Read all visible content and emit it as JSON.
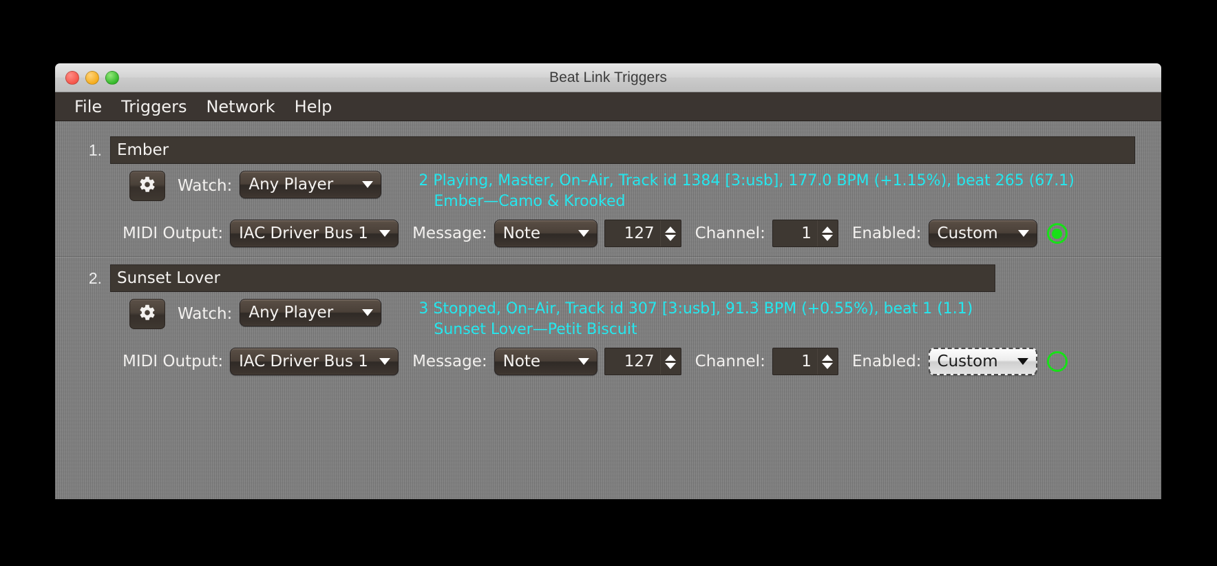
{
  "window": {
    "title": "Beat Link Triggers",
    "traffic_lights": [
      "close-button",
      "minimize-button",
      "zoom-button"
    ]
  },
  "menubar": {
    "items": [
      {
        "label": "File"
      },
      {
        "label": "Triggers"
      },
      {
        "label": "Network"
      },
      {
        "label": "Help"
      }
    ]
  },
  "labels": {
    "watch": "Watch:",
    "midi_output": "MIDI Output:",
    "message": "Message:",
    "channel": "Channel:",
    "enabled": "Enabled:"
  },
  "colors": {
    "status_text": "#24e7ee",
    "indicator_green": "#17e018",
    "panel_background": "#838383",
    "field_background": "#3e3832",
    "menubar_background": "#3b3531"
  },
  "triggers": [
    {
      "index": "1.",
      "name": "Ember",
      "gear_icon": "gear-icon",
      "watch_value": "Any Player",
      "status_line1": "2 Playing, Master, On–Air, Track id 1384 [3:usb], 177.0 BPM (+1.15%), beat 265 (67.1)",
      "status_line2": "Ember—Camo & Krooked",
      "midi_output_value": "IAC Driver Bus 1",
      "message_value": "Note",
      "note_value": "127",
      "channel_value": "1",
      "enabled_value": "Custom",
      "enabled_focused": false,
      "indicator_state": "on"
    },
    {
      "index": "2.",
      "name": "Sunset Lover",
      "gear_icon": "gear-icon",
      "watch_value": "Any Player",
      "status_line1": "3 Stopped, On–Air, Track id 307 [3:usb], 91.3 BPM (+0.55%), beat 1 (1.1)",
      "status_line2": "Sunset Lover—Petit Biscuit",
      "midi_output_value": "IAC Driver Bus 1",
      "message_value": "Note",
      "note_value": "127",
      "channel_value": "1",
      "enabled_value": "Custom",
      "enabled_focused": true,
      "indicator_state": "off"
    }
  ]
}
